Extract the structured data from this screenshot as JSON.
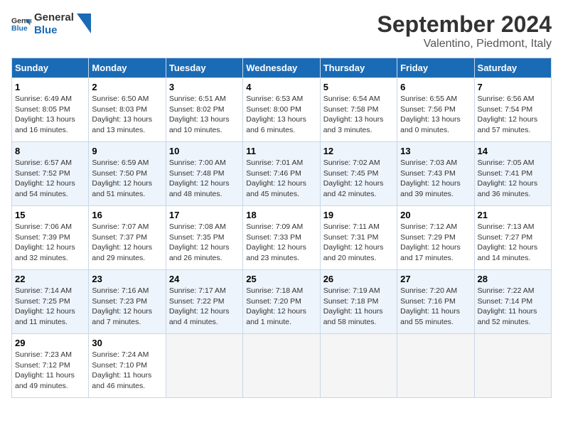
{
  "logo": {
    "line1": "General",
    "line2": "Blue"
  },
  "title": "September 2024",
  "subtitle": "Valentino, Piedmont, Italy",
  "days_header": [
    "Sunday",
    "Monday",
    "Tuesday",
    "Wednesday",
    "Thursday",
    "Friday",
    "Saturday"
  ],
  "weeks": [
    [
      {
        "day": "1",
        "lines": [
          "Sunrise: 6:49 AM",
          "Sunset: 8:05 PM",
          "Daylight: 13 hours",
          "and 16 minutes."
        ]
      },
      {
        "day": "2",
        "lines": [
          "Sunrise: 6:50 AM",
          "Sunset: 8:03 PM",
          "Daylight: 13 hours",
          "and 13 minutes."
        ]
      },
      {
        "day": "3",
        "lines": [
          "Sunrise: 6:51 AM",
          "Sunset: 8:02 PM",
          "Daylight: 13 hours",
          "and 10 minutes."
        ]
      },
      {
        "day": "4",
        "lines": [
          "Sunrise: 6:53 AM",
          "Sunset: 8:00 PM",
          "Daylight: 13 hours",
          "and 6 minutes."
        ]
      },
      {
        "day": "5",
        "lines": [
          "Sunrise: 6:54 AM",
          "Sunset: 7:58 PM",
          "Daylight: 13 hours",
          "and 3 minutes."
        ]
      },
      {
        "day": "6",
        "lines": [
          "Sunrise: 6:55 AM",
          "Sunset: 7:56 PM",
          "Daylight: 13 hours",
          "and 0 minutes."
        ]
      },
      {
        "day": "7",
        "lines": [
          "Sunrise: 6:56 AM",
          "Sunset: 7:54 PM",
          "Daylight: 12 hours",
          "and 57 minutes."
        ]
      }
    ],
    [
      {
        "day": "8",
        "lines": [
          "Sunrise: 6:57 AM",
          "Sunset: 7:52 PM",
          "Daylight: 12 hours",
          "and 54 minutes."
        ]
      },
      {
        "day": "9",
        "lines": [
          "Sunrise: 6:59 AM",
          "Sunset: 7:50 PM",
          "Daylight: 12 hours",
          "and 51 minutes."
        ]
      },
      {
        "day": "10",
        "lines": [
          "Sunrise: 7:00 AM",
          "Sunset: 7:48 PM",
          "Daylight: 12 hours",
          "and 48 minutes."
        ]
      },
      {
        "day": "11",
        "lines": [
          "Sunrise: 7:01 AM",
          "Sunset: 7:46 PM",
          "Daylight: 12 hours",
          "and 45 minutes."
        ]
      },
      {
        "day": "12",
        "lines": [
          "Sunrise: 7:02 AM",
          "Sunset: 7:45 PM",
          "Daylight: 12 hours",
          "and 42 minutes."
        ]
      },
      {
        "day": "13",
        "lines": [
          "Sunrise: 7:03 AM",
          "Sunset: 7:43 PM",
          "Daylight: 12 hours",
          "and 39 minutes."
        ]
      },
      {
        "day": "14",
        "lines": [
          "Sunrise: 7:05 AM",
          "Sunset: 7:41 PM",
          "Daylight: 12 hours",
          "and 36 minutes."
        ]
      }
    ],
    [
      {
        "day": "15",
        "lines": [
          "Sunrise: 7:06 AM",
          "Sunset: 7:39 PM",
          "Daylight: 12 hours",
          "and 32 minutes."
        ]
      },
      {
        "day": "16",
        "lines": [
          "Sunrise: 7:07 AM",
          "Sunset: 7:37 PM",
          "Daylight: 12 hours",
          "and 29 minutes."
        ]
      },
      {
        "day": "17",
        "lines": [
          "Sunrise: 7:08 AM",
          "Sunset: 7:35 PM",
          "Daylight: 12 hours",
          "and 26 minutes."
        ]
      },
      {
        "day": "18",
        "lines": [
          "Sunrise: 7:09 AM",
          "Sunset: 7:33 PM",
          "Daylight: 12 hours",
          "and 23 minutes."
        ]
      },
      {
        "day": "19",
        "lines": [
          "Sunrise: 7:11 AM",
          "Sunset: 7:31 PM",
          "Daylight: 12 hours",
          "and 20 minutes."
        ]
      },
      {
        "day": "20",
        "lines": [
          "Sunrise: 7:12 AM",
          "Sunset: 7:29 PM",
          "Daylight: 12 hours",
          "and 17 minutes."
        ]
      },
      {
        "day": "21",
        "lines": [
          "Sunrise: 7:13 AM",
          "Sunset: 7:27 PM",
          "Daylight: 12 hours",
          "and 14 minutes."
        ]
      }
    ],
    [
      {
        "day": "22",
        "lines": [
          "Sunrise: 7:14 AM",
          "Sunset: 7:25 PM",
          "Daylight: 12 hours",
          "and 11 minutes."
        ]
      },
      {
        "day": "23",
        "lines": [
          "Sunrise: 7:16 AM",
          "Sunset: 7:23 PM",
          "Daylight: 12 hours",
          "and 7 minutes."
        ]
      },
      {
        "day": "24",
        "lines": [
          "Sunrise: 7:17 AM",
          "Sunset: 7:22 PM",
          "Daylight: 12 hours",
          "and 4 minutes."
        ]
      },
      {
        "day": "25",
        "lines": [
          "Sunrise: 7:18 AM",
          "Sunset: 7:20 PM",
          "Daylight: 12 hours",
          "and 1 minute."
        ]
      },
      {
        "day": "26",
        "lines": [
          "Sunrise: 7:19 AM",
          "Sunset: 7:18 PM",
          "Daylight: 11 hours",
          "and 58 minutes."
        ]
      },
      {
        "day": "27",
        "lines": [
          "Sunrise: 7:20 AM",
          "Sunset: 7:16 PM",
          "Daylight: 11 hours",
          "and 55 minutes."
        ]
      },
      {
        "day": "28",
        "lines": [
          "Sunrise: 7:22 AM",
          "Sunset: 7:14 PM",
          "Daylight: 11 hours",
          "and 52 minutes."
        ]
      }
    ],
    [
      {
        "day": "29",
        "lines": [
          "Sunrise: 7:23 AM",
          "Sunset: 7:12 PM",
          "Daylight: 11 hours",
          "and 49 minutes."
        ]
      },
      {
        "day": "30",
        "lines": [
          "Sunrise: 7:24 AM",
          "Sunset: 7:10 PM",
          "Daylight: 11 hours",
          "and 46 minutes."
        ]
      },
      {
        "day": "",
        "lines": []
      },
      {
        "day": "",
        "lines": []
      },
      {
        "day": "",
        "lines": []
      },
      {
        "day": "",
        "lines": []
      },
      {
        "day": "",
        "lines": []
      }
    ]
  ]
}
